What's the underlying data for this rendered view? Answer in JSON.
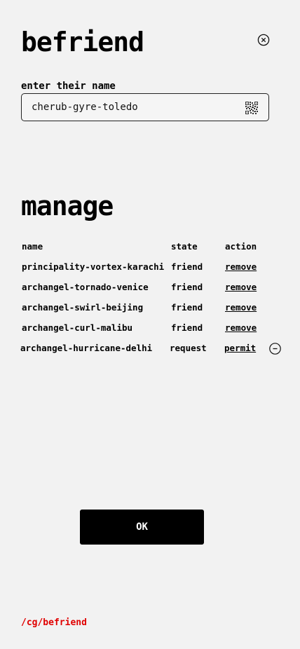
{
  "befriend": {
    "title": "befriend",
    "name_label": "enter their name",
    "name_value": "cherub-gyre-toledo"
  },
  "manage": {
    "title": "manage",
    "columns": [
      "name",
      "state",
      "action"
    ],
    "rows": [
      {
        "name": "principality-vortex-karachi",
        "state": "friend",
        "action": "remove"
      },
      {
        "name": "archangel-tornado-venice",
        "state": "friend",
        "action": "remove"
      },
      {
        "name": "archangel-swirl-beijing",
        "state": "friend",
        "action": "remove"
      },
      {
        "name": "archangel-curl-malibu",
        "state": "friend",
        "action": "remove"
      },
      {
        "name": "archangel-hurricane-delhi",
        "state": "request",
        "action": "permit"
      }
    ]
  },
  "ok_label": "OK",
  "route": "/cg/befriend",
  "icons": {
    "close": "close-circle-icon",
    "qr": "qr-code-icon",
    "decline": "minus-circle-icon"
  },
  "colors": {
    "background": "#f2f2f2",
    "route": "#e00000",
    "button": "#000000"
  }
}
